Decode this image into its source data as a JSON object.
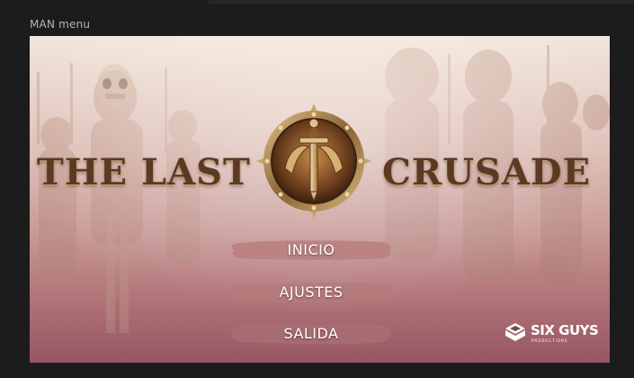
{
  "window": {
    "label": "MAN menu"
  },
  "game": {
    "title_left": "THE LAST",
    "title_right": "CRUSADE"
  },
  "menu": {
    "items": [
      {
        "label": "INICIO"
      },
      {
        "label": "AJUSTES"
      },
      {
        "label": "SALIDA"
      }
    ]
  },
  "studio": {
    "name": "SIX GUYS",
    "subtitle": "PRODUCTIONS"
  },
  "colors": {
    "title": "#5c3a22",
    "button_banner": "#b97f7f",
    "button_text": "#ffffff",
    "background_top": "#f1e6db",
    "background_bottom": "#a86570"
  },
  "icons": {
    "emblem": "sword-shield-emblem-icon",
    "studio": "six-guys-logo-icon"
  }
}
